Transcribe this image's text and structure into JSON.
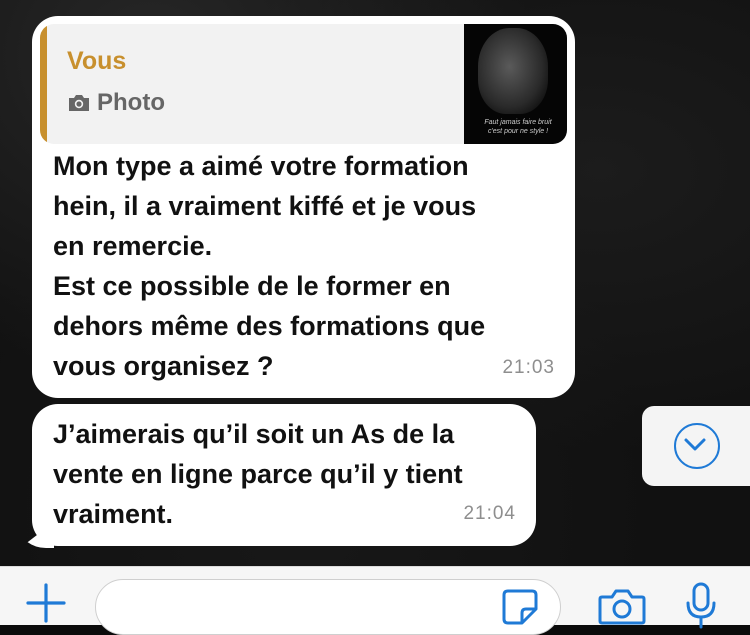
{
  "chat": {
    "messages": [
      {
        "reply": {
          "author": "Vous",
          "type": "Photo",
          "thumb_caption": "Faut jamais faire bruit\nc'est pour ne style !"
        },
        "text": "Mon type a aimé votre formation\nhein, il a vraiment kiffé et je vous\nen remercie.\nEst ce possible de le former en\ndehors même des formations que\nvous organisez ?",
        "time": "21:03"
      },
      {
        "text": "J’aimerais qu’il soit un As de la\nvente en ligne parce qu’il y tient\nvraiment.",
        "time": "21:04"
      }
    ]
  },
  "scroll_down": {
    "icon": "chevron-down-icon"
  },
  "composer": {
    "attach_icon": "plus-icon",
    "input_value": "",
    "input_placeholder": "",
    "sticker_icon": "sticker-icon",
    "camera_icon": "camera-icon",
    "mic_icon": "microphone-icon"
  },
  "colors": {
    "accent": "#1f7ad6",
    "quote_author": "#c8902e",
    "bubble": "#ffffff",
    "background": "#111111"
  }
}
